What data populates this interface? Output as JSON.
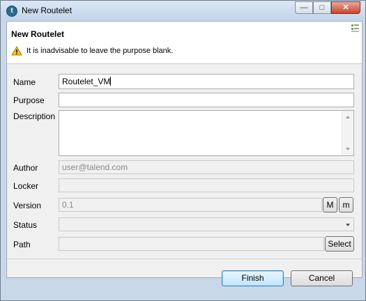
{
  "window": {
    "title": "New Routelet",
    "icon": "talend-app-icon"
  },
  "window_buttons": {
    "minimize": "—",
    "maximize": "□",
    "close": "✕"
  },
  "header": {
    "title": "New Routelet",
    "warning": "It is inadvisable to leave the purpose blank."
  },
  "form": {
    "name": {
      "label": "Name",
      "value": "Routelet_VM"
    },
    "purpose": {
      "label": "Purpose",
      "value": ""
    },
    "description": {
      "label": "Description",
      "value": ""
    },
    "author": {
      "label": "Author",
      "value": "user@talend.com"
    },
    "locker": {
      "label": "Locker",
      "value": ""
    },
    "version": {
      "label": "Version",
      "value": "0.1",
      "major_label": "M",
      "minor_label": "m"
    },
    "status": {
      "label": "Status",
      "value": ""
    },
    "path": {
      "label": "Path",
      "value": "",
      "select_label": "Select"
    }
  },
  "buttons": {
    "finish": "Finish",
    "cancel": "Cancel"
  },
  "colors": {
    "warning": "#f2c12e",
    "accent": "#3c7fb1",
    "titlebar": "#c9d8e9"
  }
}
